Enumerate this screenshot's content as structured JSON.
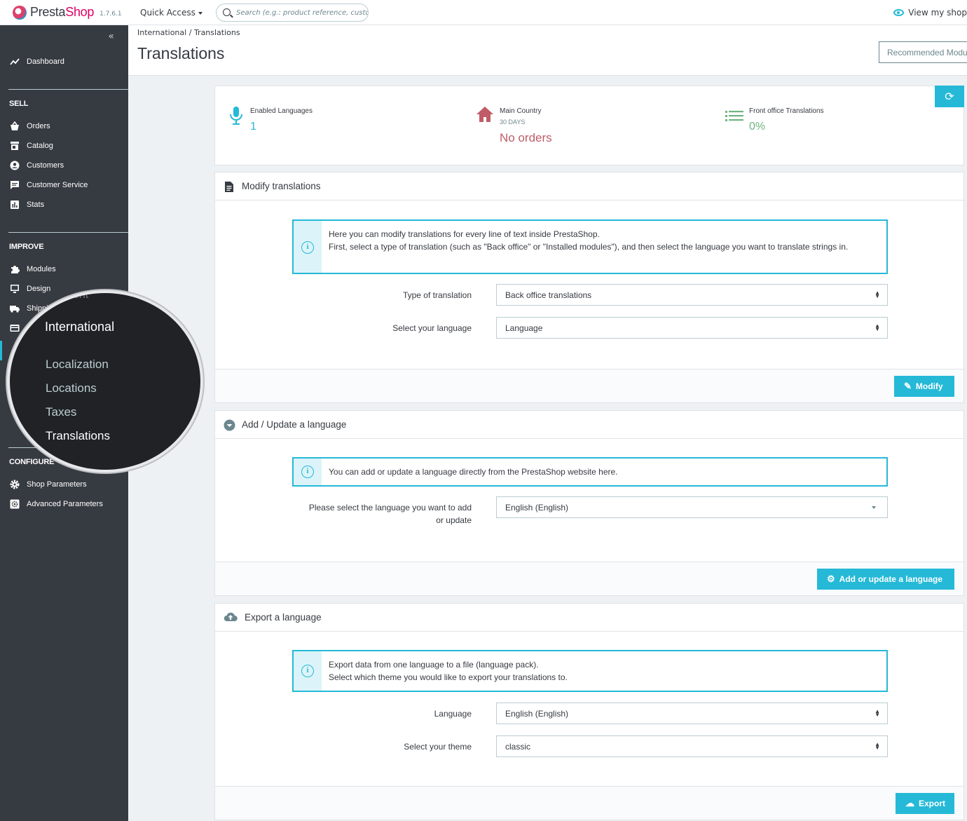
{
  "header": {
    "logo_text_1": "Presta",
    "logo_text_2": "Shop",
    "version": "1.7.6.1",
    "quick_access": "Quick Access",
    "search_placeholder": "Search (e.g.: product reference, custome",
    "view_shop": "View my shop"
  },
  "sidebar": {
    "collapse": "«",
    "dashboard": "Dashboard",
    "sell_title": "SELL",
    "sell_items": [
      "Orders",
      "Catalog",
      "Customers",
      "Customer Service",
      "Stats"
    ],
    "improve_title": "IMPROVE",
    "improve_items": [
      "Modules",
      "Design",
      "Shippi"
    ],
    "configure_title": "CONFIGURE",
    "configure_items": [
      "Shop Parameters",
      "Advanced Parameters"
    ]
  },
  "magnifier": {
    "ghost": "ent",
    "title": "International",
    "items": [
      "Localization",
      "Locations",
      "Taxes",
      "Translations"
    ],
    "active": "Translations"
  },
  "page": {
    "breadcrumb_parent": "International",
    "breadcrumb_sep": "/",
    "breadcrumb_current": "Translations",
    "title": "Translations",
    "recommended_button": "Recommended Modules"
  },
  "kpi": {
    "enabled_languages_label": "Enabled Languages",
    "enabled_languages_value": "1",
    "main_country_label": "Main Country",
    "main_country_sub": "30 DAYS",
    "main_country_value": "No orders",
    "front_office_label": "Front office Translations",
    "front_office_value": "0%"
  },
  "modify": {
    "title": "Modify translations",
    "alert_line1": "Here you can modify translations for every line of text inside PrestaShop.",
    "alert_line2": "First, select a type of translation (such as \"Back office\" or \"Installed modules\"), and then select the language you want to translate strings in.",
    "type_label": "Type of translation",
    "type_value": "Back office translations",
    "language_label": "Select your language",
    "language_value": "Language",
    "button": "Modify"
  },
  "add_update": {
    "title": "Add / Update a language",
    "alert": "You can add or update a language directly from the PrestaShop website here.",
    "select_label_1": "Please select the language you want to add",
    "select_label_2": "or update",
    "select_value": "English (English)",
    "button": "Add or update a language"
  },
  "export": {
    "title": "Export a language",
    "alert_line1": "Export data from one language to a file (language pack).",
    "alert_line2": "Select which theme you would like to export your translations to.",
    "language_label": "Language",
    "language_value": "English (English)",
    "theme_label": "Select your theme",
    "theme_value": "classic",
    "button": "Export"
  },
  "colors": {
    "primary": "#25b9d7",
    "sidebar": "#363a41",
    "danger": "#c05c67",
    "success": "#70b580"
  }
}
